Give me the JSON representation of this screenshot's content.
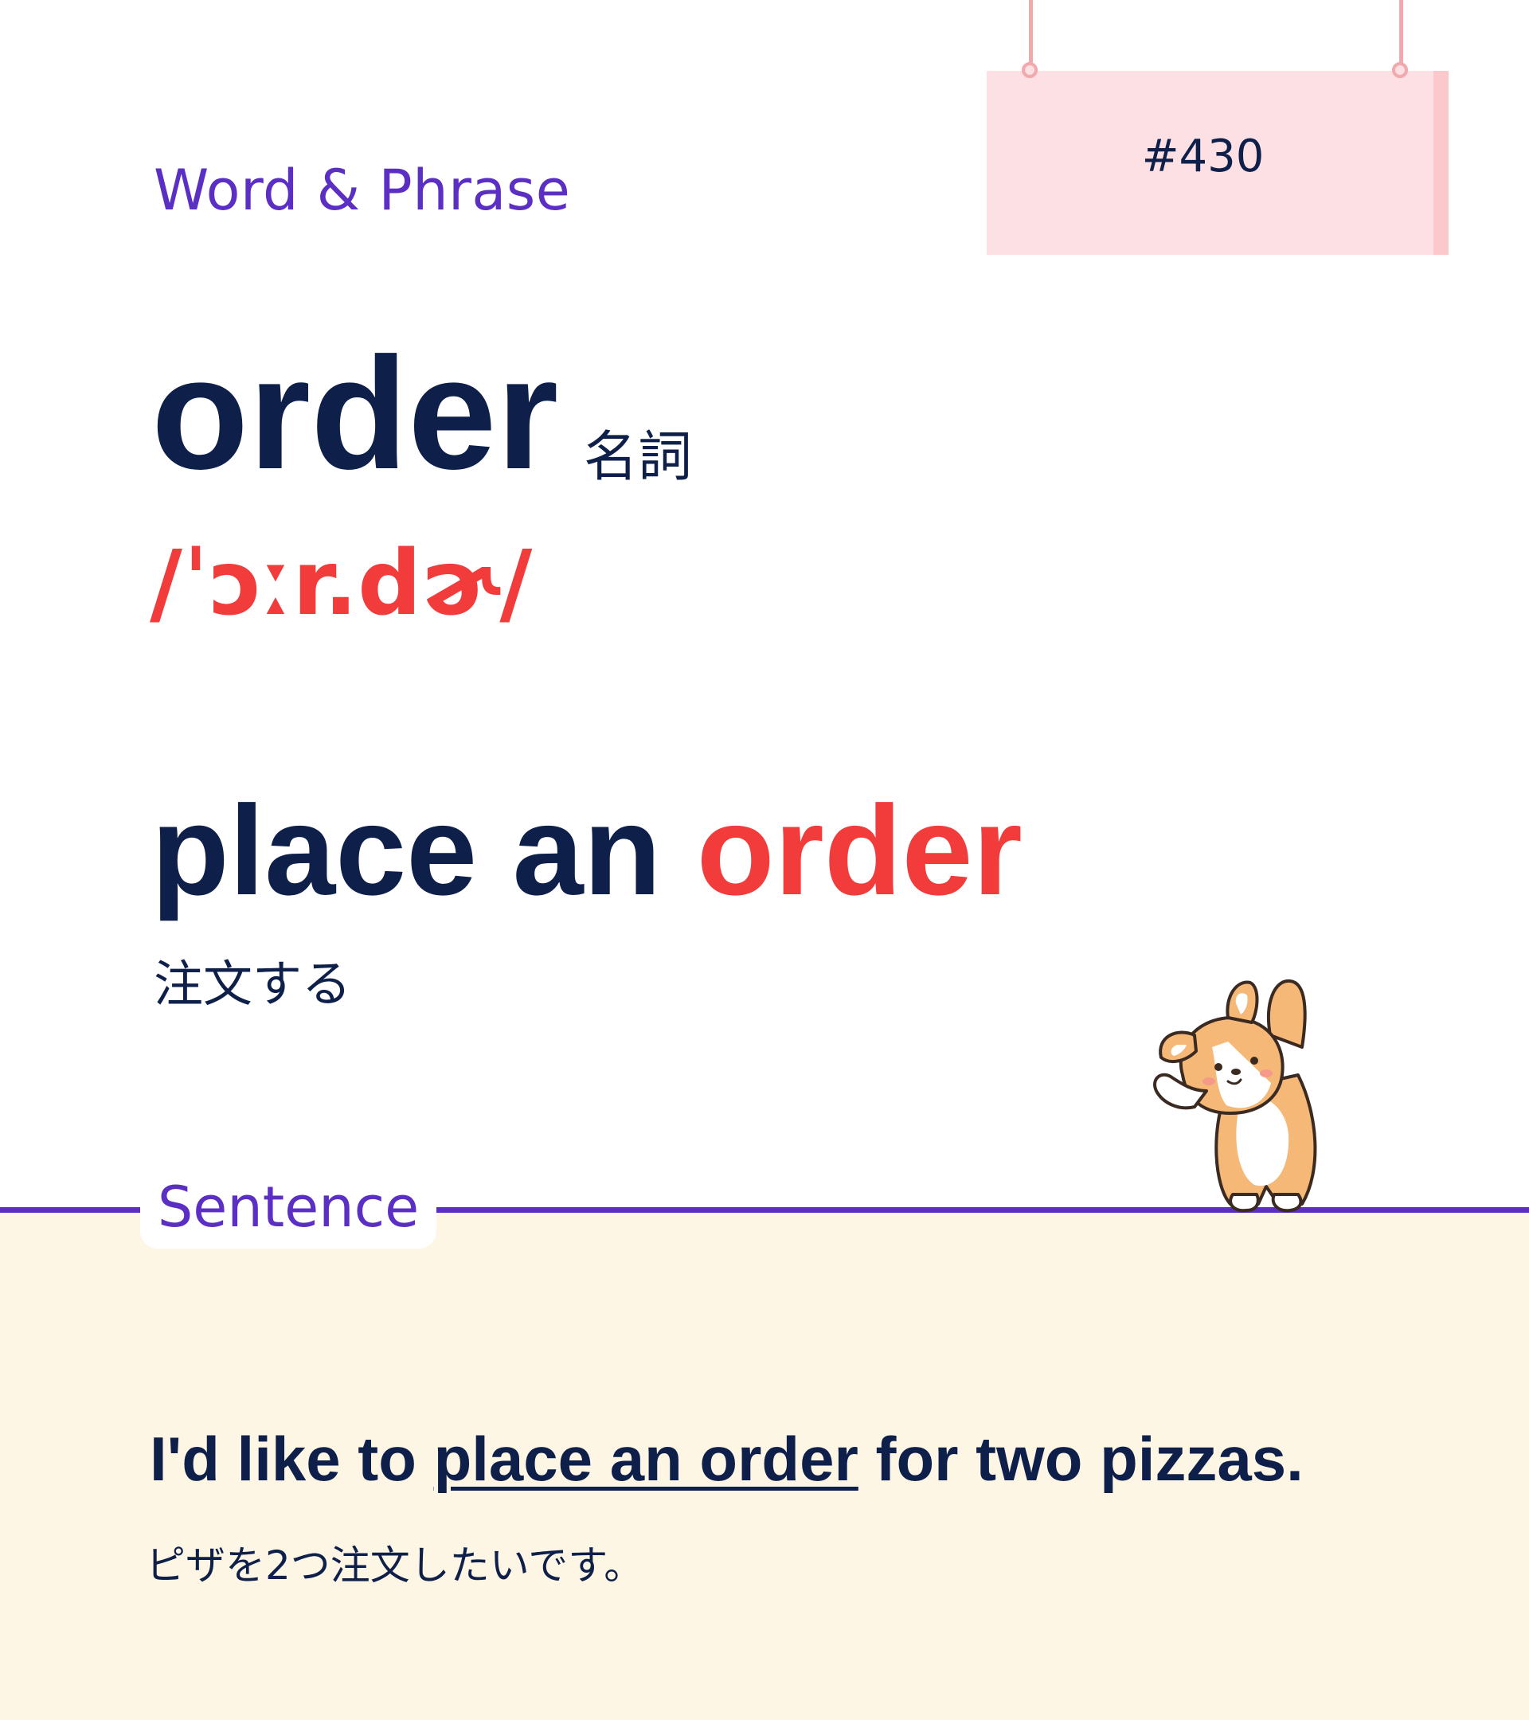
{
  "header": {
    "section_label": "Word & Phrase",
    "card_number": "#430"
  },
  "word": {
    "headword": "order",
    "part_of_speech": "名詞",
    "pronunciation": "/ˈɔːr.dɚ/"
  },
  "phrase": {
    "prefix": "place an ",
    "highlight": "order",
    "translation": "注文する"
  },
  "sentence_section": {
    "label": "Sentence",
    "sentence_before": "I'd like to ",
    "sentence_underlined": "place an order",
    "sentence_after": " for two pizzas.",
    "translation": "ピザを2つ注文したいです。"
  },
  "colors": {
    "navy": "#0e1f4a",
    "accent_purple": "#5b2fc4",
    "highlight_red": "#f23c3c",
    "sign_pink": "#fde0e3",
    "panel_cream": "#fdf6e4"
  },
  "icons": {
    "mascot": "corgi-mascot-icon"
  }
}
